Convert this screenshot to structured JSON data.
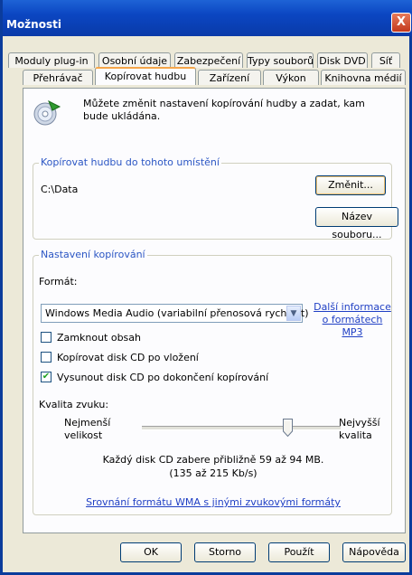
{
  "window": {
    "title": "Možnosti",
    "close_glyph": "X"
  },
  "tabs_back": [
    "Moduly plug-in",
    "Osobní údaje",
    "Zabezpečení",
    "Typy souborů",
    "Disk DVD",
    "Síť"
  ],
  "tabs_front": [
    "Přehrávač",
    "Kopírovat hudbu",
    "Zařízení",
    "Výkon",
    "Knihovna médií"
  ],
  "active_tab": "Kopírovat hudbu",
  "intro_text": "Můžete změnit nastavení kopírování hudby a zadat, kam bude ukládána.",
  "location": {
    "legend": "Kopírovat hudbu do tohoto umístění",
    "path": "C:\\Data",
    "change_button": "Změnit...",
    "filename_button": "Název souboru..."
  },
  "settings": {
    "legend": "Nastavení kopírování",
    "format_label": "Formát:",
    "format_value": "Windows Media Audio (variabilní přenosová rychlost)",
    "more_info_link_line1": "Další informace",
    "more_info_link_line2": "o formátech MP3",
    "checkboxes": [
      {
        "label": "Zamknout obsah",
        "checked": false
      },
      {
        "label": "Kopírovat disk CD po vložení",
        "checked": false
      },
      {
        "label": "Vysunout disk CD po dokončení kopírování",
        "checked": true
      }
    ],
    "quality_label": "Kvalita zvuku:",
    "min_label_line1": "Nejmenší",
    "min_label_line2": "velikost",
    "max_label_line1": "Nejvyšší",
    "max_label_line2": "kvalita",
    "quality_level": 0.73,
    "size_info_line1": "Každý disk CD zabere přibližně 59 až 94 MB.",
    "size_info_line2": "(135 až 215 Kb/s)",
    "compare_link": "Srovnání formátu WMA s jinými zvukovými formáty"
  },
  "footer": {
    "ok": "OK",
    "cancel": "Storno",
    "apply": "Použít",
    "help": "Nápověda"
  },
  "colors": {
    "title_bar": "#0b46c2",
    "legend_text": "#2b56c4",
    "link": "#1f3fc4",
    "panel_bg": "#fcfcfe",
    "dialog_bg": "#ece9d8"
  },
  "icons": {
    "cd": "cd-rip-icon",
    "slider_thumb": "slider-thumb-icon",
    "check": "check-mark-icon"
  }
}
